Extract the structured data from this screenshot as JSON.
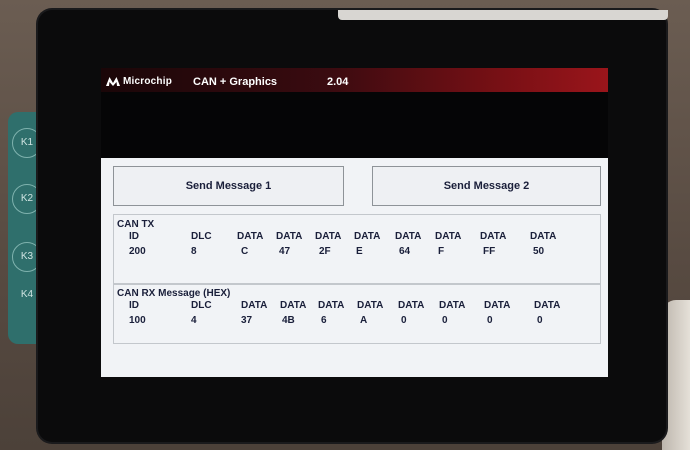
{
  "header": {
    "brand": "Microchip",
    "title": "CAN + Graphics",
    "version": "2.04"
  },
  "buttons": {
    "send1": "Send Message 1",
    "send2": "Send Message 2"
  },
  "can_tx": {
    "label": "CAN TX",
    "headers": [
      "ID",
      "DLC",
      "DATA",
      "DATA",
      "DATA",
      "DATA",
      "DATA",
      "DATA",
      "DATA",
      "DATA"
    ],
    "values": [
      "200",
      "8",
      "C",
      "47",
      "2F",
      "E",
      "64",
      "F",
      "FF",
      "50"
    ]
  },
  "can_rx": {
    "label": "CAN RX Message (HEX)",
    "headers": [
      "ID",
      "DLC",
      "DATA",
      "DATA",
      "DATA",
      "DATA",
      "DATA",
      "DATA",
      "DATA",
      "DATA"
    ],
    "values": [
      "100",
      "4",
      "37",
      "4B",
      "6",
      "A",
      "0",
      "0",
      "0",
      "0"
    ]
  },
  "board_keys": [
    "K1",
    "K2",
    "K3",
    "K4"
  ],
  "colors": {
    "header_red": "#9a151b",
    "panel": "#f1f3f6",
    "text": "#1a1f3a"
  }
}
